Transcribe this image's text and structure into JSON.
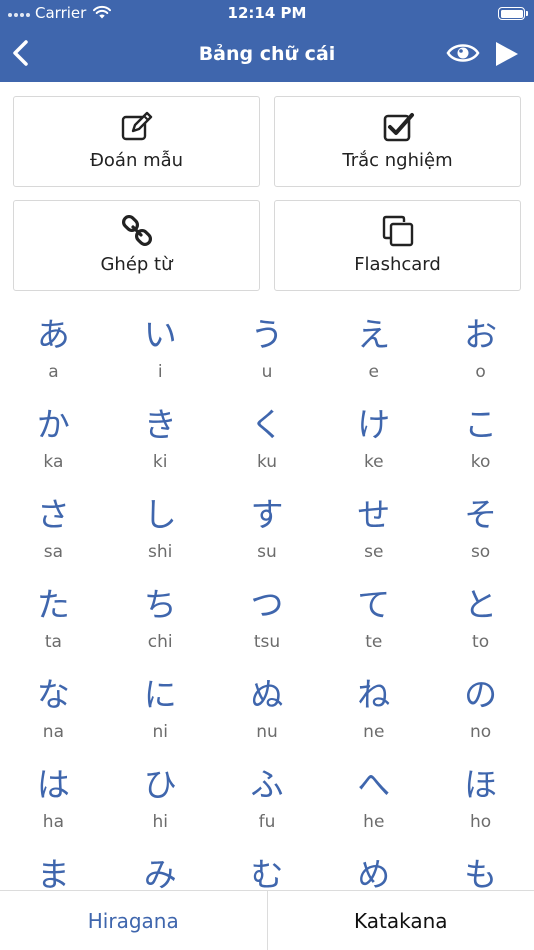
{
  "status_bar": {
    "carrier": "Carrier",
    "time": "12:14 PM"
  },
  "nav": {
    "title": "Bảng chữ cái",
    "accent": "#3f66ad"
  },
  "modes": [
    {
      "label": "Đoán mẫu",
      "icon": "edit-icon"
    },
    {
      "label": "Trắc nghiệm",
      "icon": "checkbox-icon"
    },
    {
      "label": "Ghép từ",
      "icon": "link-icon"
    },
    {
      "label": "Flashcard",
      "icon": "copy-icon"
    }
  ],
  "kana_rows": [
    [
      {
        "kana": "あ",
        "romaji": "a"
      },
      {
        "kana": "い",
        "romaji": "i"
      },
      {
        "kana": "う",
        "romaji": "u"
      },
      {
        "kana": "え",
        "romaji": "e"
      },
      {
        "kana": "お",
        "romaji": "o"
      }
    ],
    [
      {
        "kana": "か",
        "romaji": "ka"
      },
      {
        "kana": "き",
        "romaji": "ki"
      },
      {
        "kana": "く",
        "romaji": "ku"
      },
      {
        "kana": "け",
        "romaji": "ke"
      },
      {
        "kana": "こ",
        "romaji": "ko"
      }
    ],
    [
      {
        "kana": "さ",
        "romaji": "sa"
      },
      {
        "kana": "し",
        "romaji": "shi"
      },
      {
        "kana": "す",
        "romaji": "su"
      },
      {
        "kana": "せ",
        "romaji": "se"
      },
      {
        "kana": "そ",
        "romaji": "so"
      }
    ],
    [
      {
        "kana": "た",
        "romaji": "ta"
      },
      {
        "kana": "ち",
        "romaji": "chi"
      },
      {
        "kana": "つ",
        "romaji": "tsu"
      },
      {
        "kana": "て",
        "romaji": "te"
      },
      {
        "kana": "と",
        "romaji": "to"
      }
    ],
    [
      {
        "kana": "な",
        "romaji": "na"
      },
      {
        "kana": "に",
        "romaji": "ni"
      },
      {
        "kana": "ぬ",
        "romaji": "nu"
      },
      {
        "kana": "ね",
        "romaji": "ne"
      },
      {
        "kana": "の",
        "romaji": "no"
      }
    ],
    [
      {
        "kana": "は",
        "romaji": "ha"
      },
      {
        "kana": "ひ",
        "romaji": "hi"
      },
      {
        "kana": "ふ",
        "romaji": "fu"
      },
      {
        "kana": "へ",
        "romaji": "he"
      },
      {
        "kana": "ほ",
        "romaji": "ho"
      }
    ],
    [
      {
        "kana": "ま",
        "romaji": ""
      },
      {
        "kana": "み",
        "romaji": ""
      },
      {
        "kana": "む",
        "romaji": ""
      },
      {
        "kana": "め",
        "romaji": ""
      },
      {
        "kana": "も",
        "romaji": ""
      }
    ]
  ],
  "tabs": {
    "hiragana": "Hiragana",
    "katakana": "Katakana",
    "active": "hiragana"
  }
}
